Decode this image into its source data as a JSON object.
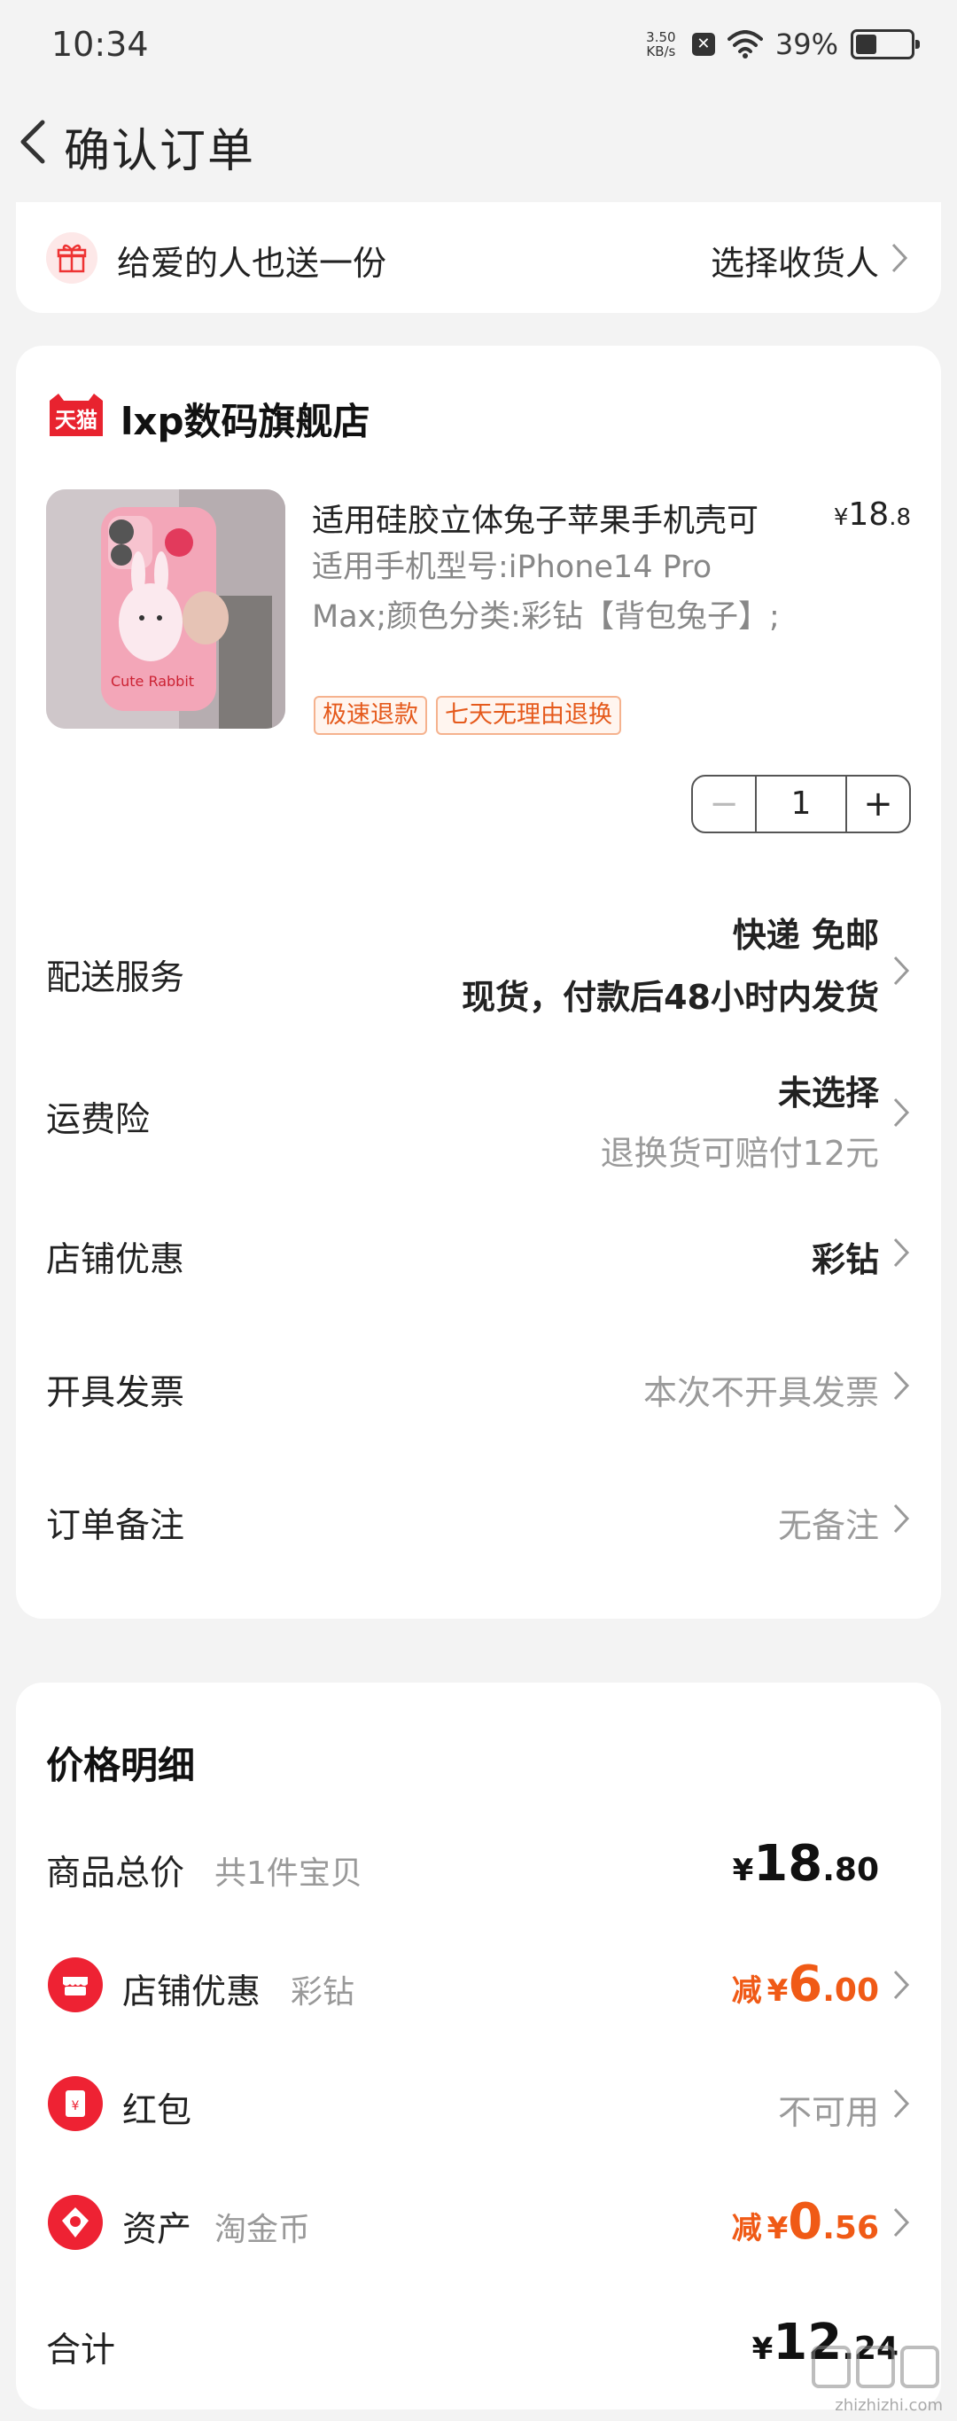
{
  "status": {
    "time": "10:34",
    "net_speed_value": "3.50",
    "net_speed_unit": "KB/s",
    "battery": "39%",
    "battery_level": 0.39
  },
  "header": {
    "title": "确认订单"
  },
  "gift": {
    "label": "给爱的人也送一份",
    "action": "选择收货人"
  },
  "store": {
    "name": "lxp数码旗舰店",
    "logo_text": "天猫"
  },
  "product": {
    "title": "适用硅胶立体兔子苹果手机壳可",
    "price_currency": "¥",
    "price_int": "18",
    "price_dec": ".8",
    "spec": "适用手机型号:iPhone14 Pro Max;颜色分类:彩钻【背包兔子】;",
    "tags": [
      "极速退款",
      "七天无理由退换"
    ],
    "quantity": "1",
    "minus_symbol": "−",
    "plus_symbol": "+"
  },
  "rows": {
    "delivery": {
      "label": "配送服务",
      "line1": "快递 免邮",
      "line2": "现货，付款后48小时内发货"
    },
    "insurance": {
      "label": "运费险",
      "line1": "未选择",
      "line2": "退换货可赔付12元"
    },
    "store_discount": {
      "label": "店铺优惠",
      "value": "彩钻"
    },
    "invoice": {
      "label": "开具发票",
      "value": "本次不开具发票"
    },
    "note": {
      "label": "订单备注",
      "value": "无备注"
    }
  },
  "price": {
    "title": "价格明细",
    "goods": {
      "label": "商品总价",
      "sub": "共1件宝贝",
      "currency": "¥",
      "int": "18",
      "dec": ".80"
    },
    "store": {
      "label": "店铺优惠",
      "sub": "彩钻",
      "minus": "减",
      "currency": "¥",
      "int": "6",
      "dec": ".00"
    },
    "redpacket": {
      "label": "红包",
      "value": "不可用"
    },
    "assets": {
      "label": "资产",
      "sub": "淘金币",
      "minus": "减",
      "currency": "¥",
      "int": "0",
      "dec": ".56"
    },
    "total": {
      "label": "合计",
      "currency": "¥",
      "int": "12",
      "dec": ".24"
    }
  },
  "watermark": "zhizhizhi.com",
  "colors": {
    "accent": "#f05a16",
    "brand_red": "#ee2233",
    "tag_orange": "#e55a1c",
    "bg": "#f3f3f3"
  }
}
